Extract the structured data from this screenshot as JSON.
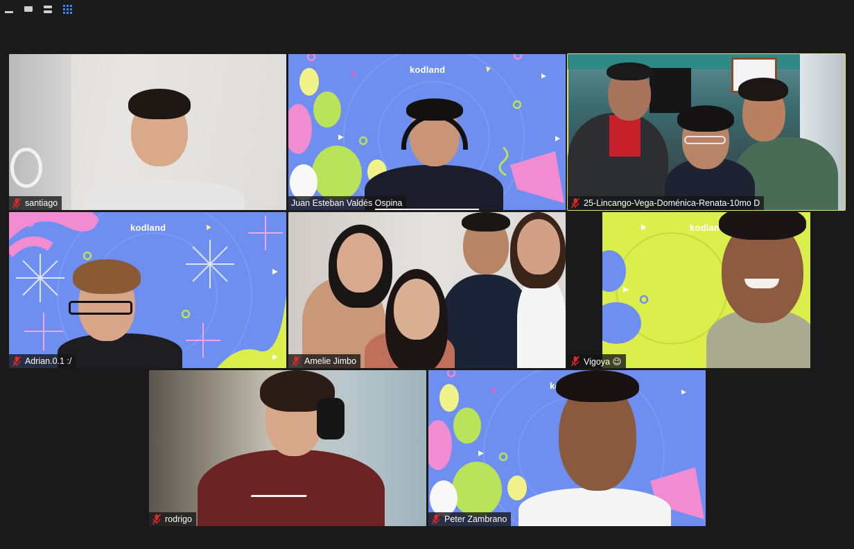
{
  "toolbar": {
    "views": [
      "minimize-view",
      "speaker-view",
      "stacked-view",
      "gallery-view"
    ],
    "active_view": "gallery-view"
  },
  "participants": [
    {
      "name": "santiago",
      "muted": true
    },
    {
      "name": "Juan Esteban Valdés Ospina",
      "muted": false
    },
    {
      "name": "25-Lincango-Vega-Doménica-Renata-10mo D",
      "muted": true,
      "active_speaker": true
    },
    {
      "name": "Adrian.0.1 :/",
      "muted": true
    },
    {
      "name": "Amelie Jimbo",
      "muted": true
    },
    {
      "name": "Vigoya 😉",
      "muted": true
    },
    {
      "name": "rodrigo",
      "muted": true
    },
    {
      "name": "Peter Zambrano",
      "muted": true
    }
  ],
  "background_brand": "kodland",
  "colors": {
    "background": "#1a1a1a",
    "active_outline": "#e9e46a",
    "muted_icon": "#e02828",
    "gallery_icon": "#2d8cff"
  }
}
